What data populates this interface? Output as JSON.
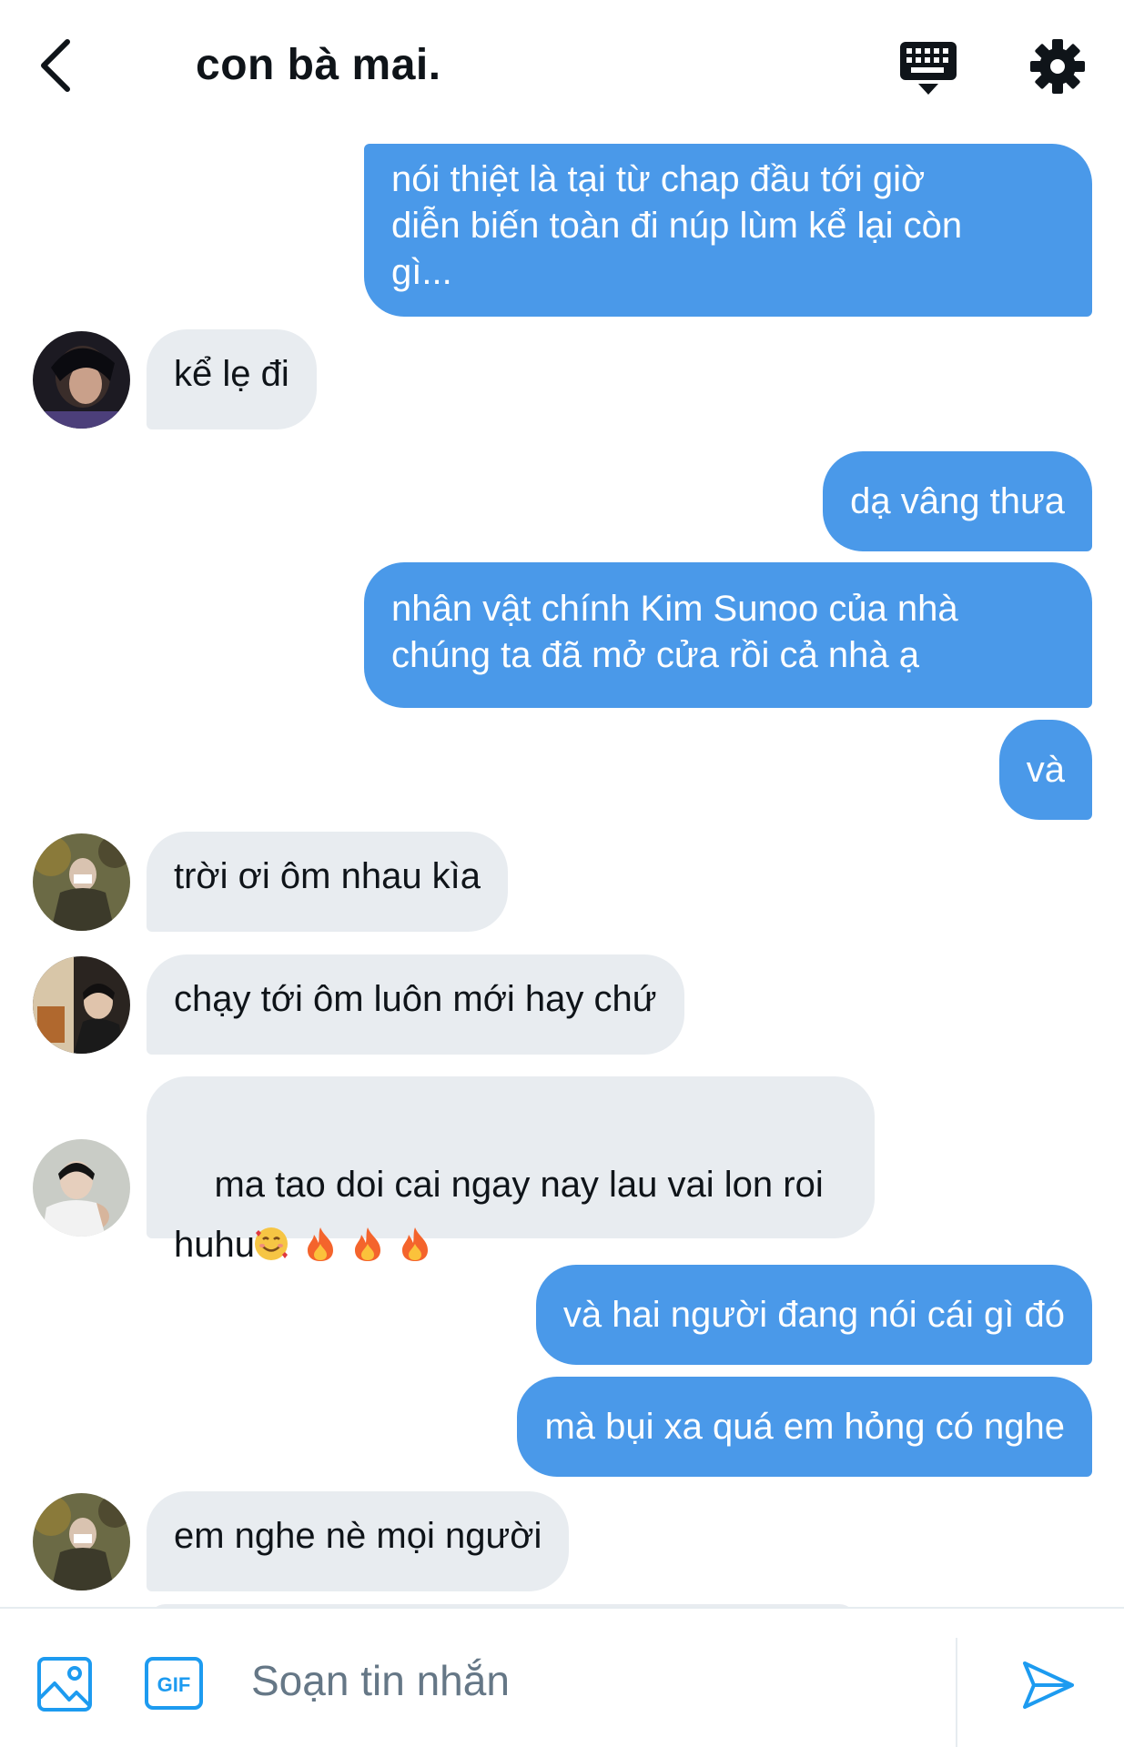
{
  "header": {
    "title": "con bà mai.",
    "back_icon": "chevron-left-icon",
    "keyboard_icon": "keyboard-icon",
    "settings_icon": "gear-icon"
  },
  "messages": [
    {
      "direction": "out",
      "text": "nói thiệt là tại từ chap đầu tới giờ\ndiễn biến toàn đi núp lùm kể lại còn\ngì..."
    },
    {
      "direction": "in",
      "text": "kể lẹ đi"
    },
    {
      "direction": "out",
      "text": "dạ vâng thưa"
    },
    {
      "direction": "out",
      "text": "nhân vật chính Kim Sunoo của nhà\nchúng ta đã mở cửa rồi cả nhà ạ"
    },
    {
      "direction": "out",
      "text": "và"
    },
    {
      "direction": "in",
      "text": "trời ơi ôm nhau kìa"
    },
    {
      "direction": "in",
      "text": "chạy tới ôm luôn mới hay chứ"
    },
    {
      "direction": "in",
      "text": "ma tao doi cai ngay nay lau vai lon roi\nhuhu",
      "emoji": "🥰🔥🔥🔥"
    },
    {
      "direction": "out",
      "text": "và hai người đang nói cái gì đó"
    },
    {
      "direction": "out",
      "text": "mà bụi xa quá em hỏng có nghe"
    },
    {
      "direction": "in",
      "text": "em nghe nè mọi người"
    }
  ],
  "composer": {
    "placeholder": "Soạn tin nhắn",
    "image_icon": "image-icon",
    "gif_label": "GIF",
    "send_icon": "send-icon"
  },
  "colors": {
    "outgoing_bubble": "#4a99e9",
    "incoming_bubble": "#e8ecf0",
    "accent": "#1d9bf0",
    "text": "#0f1419"
  }
}
